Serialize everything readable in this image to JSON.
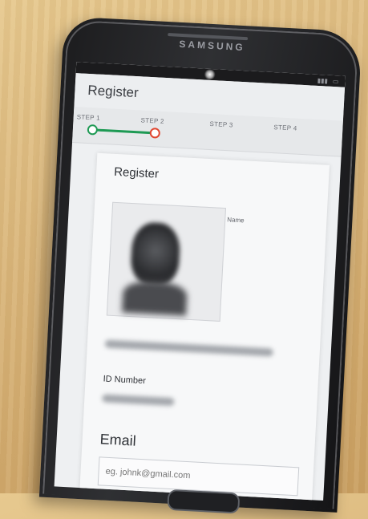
{
  "device": {
    "brand": "SAMSUNG"
  },
  "app": {
    "title": "Register"
  },
  "stepper": {
    "steps": [
      "STEP 1",
      "STEP 2",
      "STEP 3",
      "STEP 4"
    ],
    "current_step": 2,
    "completed_color": "#1e9a54",
    "current_color": "#e0452f"
  },
  "form": {
    "title": "Register",
    "name_label": "Name",
    "id_label": "ID Number",
    "email_label": "Email",
    "email_placeholder": "eg. johnk@gmail.com"
  },
  "icons": [
    "user-photo",
    "home-button"
  ]
}
